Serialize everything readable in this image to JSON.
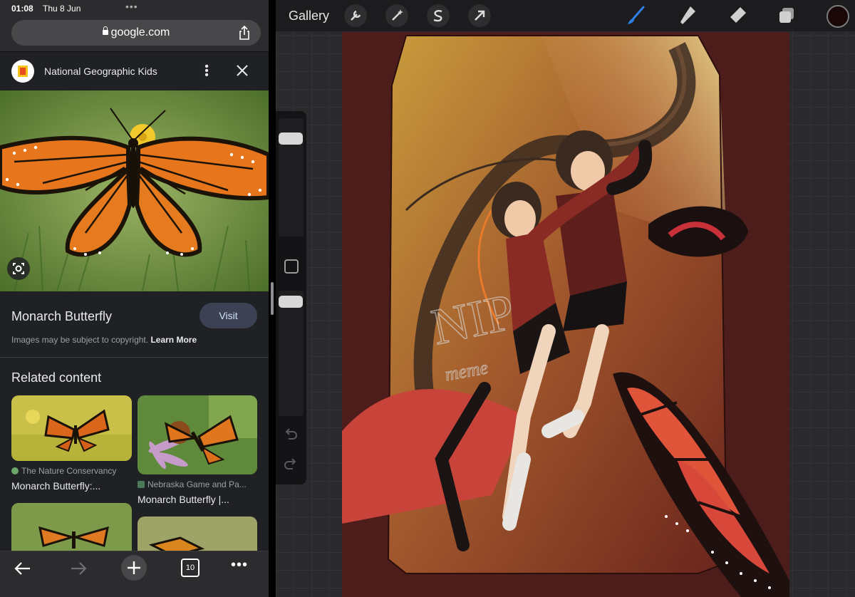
{
  "status": {
    "time": "01:08",
    "date": "Thu 8 Jun"
  },
  "browser": {
    "url": "google.com",
    "source_name": "National Geographic Kids",
    "result_title": "Monarch Butterfly",
    "visit_label": "Visit",
    "copyright_text": "Images may be subject to copyright.",
    "learn_more": "Learn More",
    "related_title": "Related content",
    "related": [
      {
        "source": "The Nature Conservancy",
        "title": "Monarch Butterfly:..."
      },
      {
        "source": "Nebraska Game and Pa...",
        "title": "Monarch Butterfly |..."
      }
    ],
    "tab_count": "10"
  },
  "procreate": {
    "gallery_label": "Gallery",
    "current_color": "#1a0808",
    "accent_color": "#2f7fe8"
  },
  "artwork": {
    "signature": "NIP",
    "signature_sub": "meme"
  }
}
